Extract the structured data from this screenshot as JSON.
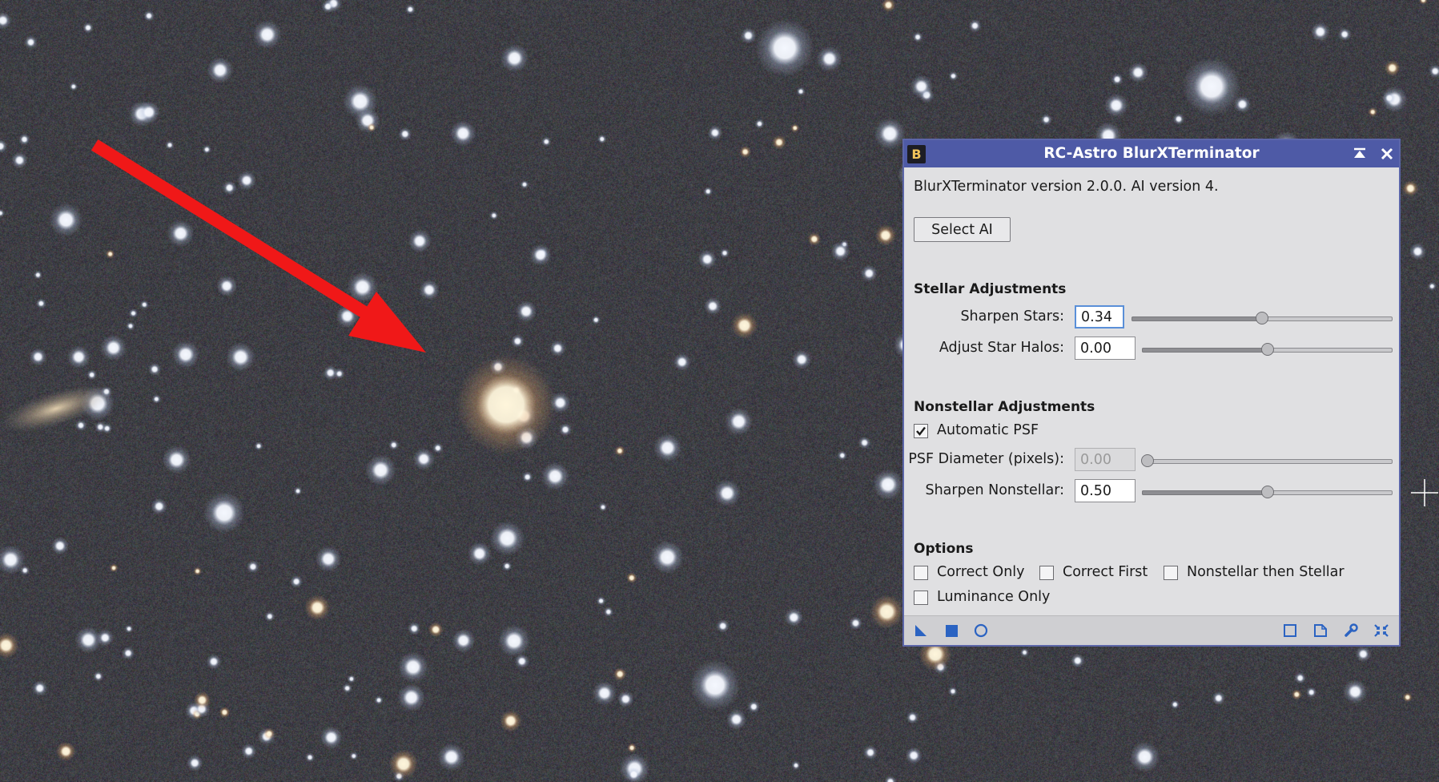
{
  "dialog": {
    "title": "RC-Astro BlurXTerminator",
    "badge": "B",
    "version_text": "BlurXTerminator version 2.0.0. AI version 4.",
    "select_ai_label": "Select AI",
    "stellar": {
      "heading": "Stellar Adjustments",
      "sharpen_stars_label": "Sharpen Stars:",
      "sharpen_stars_value": "0.34",
      "sharpen_stars_fraction": 0.5,
      "adjust_halos_label": "Adjust Star Halos:",
      "adjust_halos_value": "0.00",
      "adjust_halos_fraction": 0.5
    },
    "nonstellar": {
      "heading": "Nonstellar Adjustments",
      "auto_psf_label": "Automatic PSF",
      "auto_psf_checked": true,
      "psf_diameter_label": "PSF Diameter (pixels):",
      "psf_diameter_value": "0.00",
      "psf_diameter_fraction": 0.0,
      "sharpen_nonstellar_label": "Sharpen Nonstellar:",
      "sharpen_nonstellar_value": "0.50",
      "sharpen_nonstellar_fraction": 0.5
    },
    "options": {
      "heading": "Options",
      "correct_only_label": "Correct Only",
      "correct_first_label": "Correct First",
      "nonstellar_then_stellar_label": "Nonstellar then Stellar",
      "luminance_only_label": "Luminance Only"
    }
  },
  "colors": {
    "titlebar": "#4e5aa6",
    "arrow": "#f01818",
    "footer_icons": "#2b63c2"
  }
}
